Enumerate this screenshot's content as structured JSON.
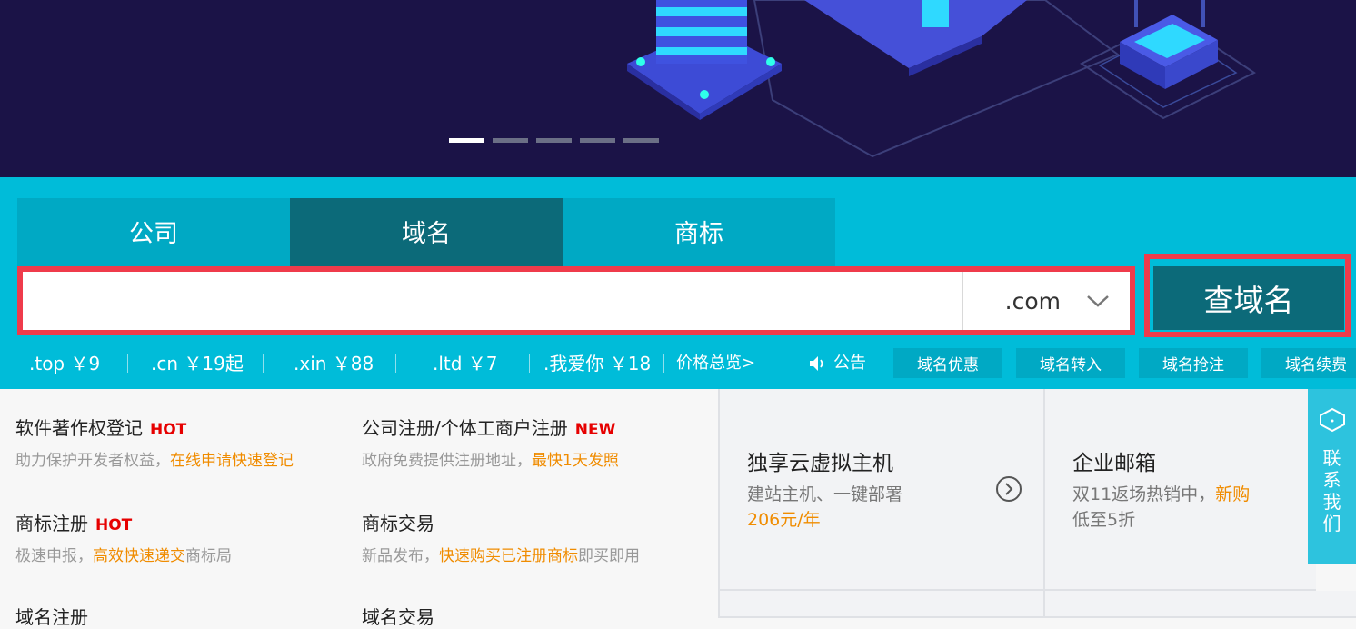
{
  "banner": {
    "slides": 5,
    "active_slide": 1
  },
  "tabs": [
    {
      "label": "公司",
      "active": false
    },
    {
      "label": "域名",
      "active": true
    },
    {
      "label": "商标",
      "active": false
    }
  ],
  "search": {
    "value": "",
    "placeholder": "",
    "suffix": ".com",
    "button_label": "查域名"
  },
  "prices": [
    {
      "label": ".top ￥9"
    },
    {
      "label": ".cn ￥19起"
    },
    {
      "label": ".xin ￥88"
    },
    {
      "label": ".ltd ￥7"
    },
    {
      "label": ".我爱你 ￥18"
    }
  ],
  "price_total": "价格总览>",
  "notice_label": "公告",
  "quick_links": [
    "域名优惠",
    "域名转入",
    "域名抢注",
    "域名续费"
  ],
  "services": [
    {
      "title": "软件著作权登记",
      "tag": "HOT",
      "desc_plain": "助力保护开发者权益，",
      "desc_highlight": "在线申请快速登记",
      "desc_tail": ""
    },
    {
      "title": "公司注册/个体工商户注册",
      "tag": "NEW",
      "desc_plain": "政府免费提供注册地址，",
      "desc_highlight": "最快1天发照",
      "desc_tail": ""
    },
    {
      "title": "商标注册",
      "tag": "HOT",
      "desc_plain": "极速申报，",
      "desc_highlight": "高效快速递交",
      "desc_tail": "商标局"
    },
    {
      "title": "商标交易",
      "tag": "",
      "desc_plain": "新品发布，",
      "desc_highlight": "快速购买已注册商标",
      "desc_tail": "即买即用"
    },
    {
      "title": "域名注册",
      "tag": "",
      "desc_plain": "",
      "desc_highlight": "",
      "desc_tail": ""
    },
    {
      "title": "域名交易",
      "tag": "",
      "desc_plain": "",
      "desc_highlight": "",
      "desc_tail": ""
    }
  ],
  "promos": [
    {
      "title": "独享云虚拟主机",
      "line1": "建站主机、一键部署",
      "line2_highlight": "206元/年"
    },
    {
      "title": "企业邮箱",
      "line1_plain": "双11返场热销中，",
      "line1_highlight": "新购",
      "line2": "低至5折"
    }
  ],
  "contact": {
    "label": "联系我们"
  },
  "colors": {
    "banner_bg": "#1b1347",
    "band_bg": "#00bcd9",
    "tab_active": "#0c6a79",
    "highlight_border": "#ef3b4b",
    "orange": "#f08c00",
    "hot_red": "#e60000"
  }
}
